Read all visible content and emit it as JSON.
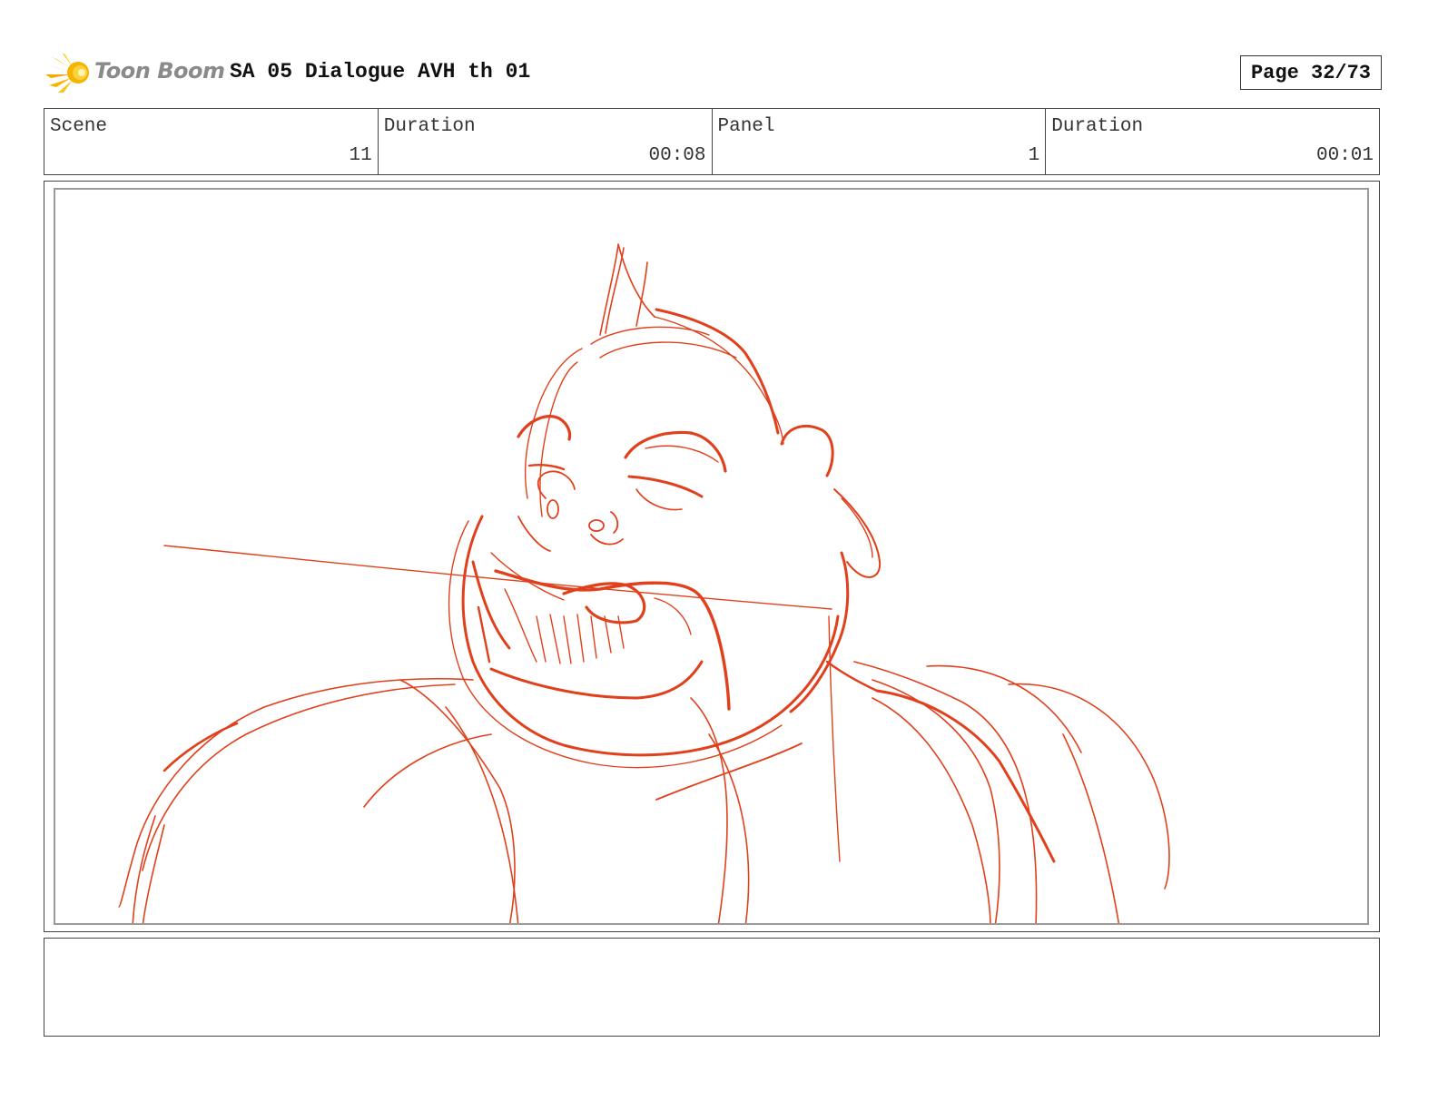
{
  "header": {
    "logo_text": "Toon Boom",
    "logo_icon": "starburst-logo-icon",
    "project_title": "SA 05 Dialogue AVH th 01",
    "page_label": "Page 32/73"
  },
  "info": {
    "scene_label": "Scene",
    "scene_value": "11",
    "scene_duration_label": "Duration",
    "scene_duration_value": "00:08",
    "panel_label": "Panel",
    "panel_value": "1",
    "panel_duration_label": "Duration",
    "panel_duration_value": "00:01"
  },
  "panel": {
    "sketch_subject": "red rough sketch of a gorilla-like character",
    "sketch_color": "#e0401c"
  },
  "notes": {
    "text": ""
  }
}
